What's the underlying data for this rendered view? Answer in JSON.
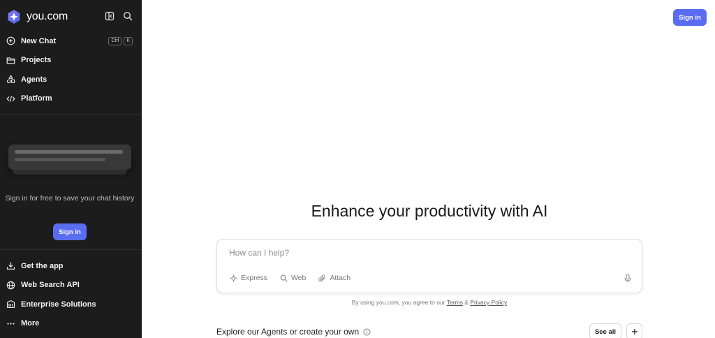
{
  "brand": {
    "name": "you.com",
    "logo_icon": "you-logo-icon"
  },
  "sidebar": {
    "top_icons": [
      "collapse-sidebar-icon",
      "search-icon"
    ],
    "nav": [
      {
        "label": "New Chat",
        "icon": "plus-circle-icon",
        "shortcut": [
          "Ctrl",
          "K"
        ]
      },
      {
        "label": "Projects",
        "icon": "folder-icon"
      },
      {
        "label": "Agents",
        "icon": "shapes-icon"
      },
      {
        "label": "Platform",
        "icon": "code-icon"
      }
    ],
    "signin_prompt": "Sign in for free to save your chat history",
    "signin_label": "Sign in",
    "bottom_nav": [
      {
        "label": "Get the app",
        "icon": "download-icon"
      },
      {
        "label": "Web Search API",
        "icon": "globe-icon"
      },
      {
        "label": "Enterprise Solutions",
        "icon": "building-icon"
      },
      {
        "label": "More",
        "icon": "ellipsis-icon"
      }
    ]
  },
  "header": {
    "signin_label": "Sign in"
  },
  "main": {
    "headline": "Enhance your productivity with AI",
    "input_placeholder": "How can I help?",
    "tools": [
      {
        "label": "Express",
        "icon": "sparkle-icon"
      },
      {
        "label": "Web",
        "icon": "search-icon"
      },
      {
        "label": "Attach",
        "icon": "paperclip-icon"
      }
    ],
    "mic_icon": "microphone-icon",
    "terms_prefix": "By using you.com, you agree to our",
    "terms_link": "Terms",
    "terms_amp": "&",
    "privacy_link": "Privacy Policy",
    "explore_title": "Explore our Agents or create your own",
    "see_all_label": "See all"
  },
  "colors": {
    "sidebar_bg": "#1c1c1c",
    "accent": "#5a6cf0"
  }
}
